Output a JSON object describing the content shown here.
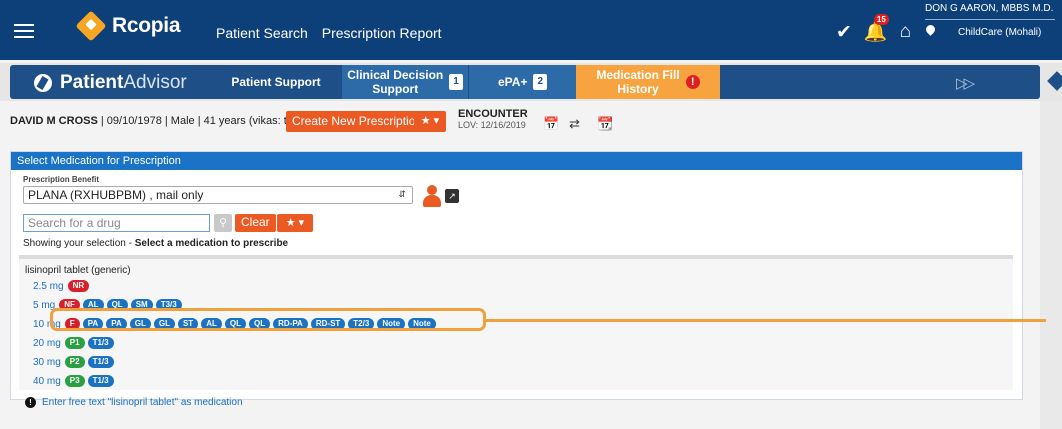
{
  "topbar": {
    "brand": "Rcopia",
    "nav": [
      "Patient Search",
      "Prescription Report"
    ],
    "notification_count": "15",
    "user_name": "DON G AARON, MBBS M.D.",
    "location": "ChildCare (Mohali)"
  },
  "subnav": {
    "logo_bold": "Patient",
    "logo_light": "Advisor",
    "tabs": {
      "patient_support": "Patient Support",
      "cds_line1": "Clinical Decision",
      "cds_line2": "Support",
      "cds_count": "1",
      "epa": "ePA+",
      "epa_count": "2",
      "mfh_line1": "Medication Fill",
      "mfh_line2": "History",
      "mfh_alert": "!"
    }
  },
  "patient": {
    "name": "DAVID M CROSS",
    "details": " | 09/10/1978 | Male | 41 years (vikas: tgy)",
    "create_button": "Create New Prescription",
    "encounter_label": "ENCOUNTER",
    "encounter_lov": "LOV: 12/16/2019"
  },
  "panel": {
    "title": "Select Medication for Prescription",
    "benefit_label": "Prescription Benefit",
    "benefit_value": "PLANA (RXHUBPBM) , mail only",
    "search_placeholder": "Search for a drug",
    "clear_label": "Clear",
    "showing_prefix": "Showing your selection - ",
    "showing_bold": "Select a medication to prescribe",
    "drug_name": "lisinopril tablet (generic)",
    "doses": [
      {
        "label": "2.5 mg",
        "pills": [
          {
            "t": "NR",
            "c": "red"
          }
        ]
      },
      {
        "label": "5 mg",
        "pills": [
          {
            "t": "NF",
            "c": "red"
          },
          {
            "t": "AL",
            "c": "blue"
          },
          {
            "t": "QL",
            "c": "blue"
          },
          {
            "t": "SM",
            "c": "blue"
          },
          {
            "t": "T3/3",
            "c": "blue"
          }
        ]
      },
      {
        "label": "10 mg",
        "pills": [
          {
            "t": "F",
            "c": "red"
          },
          {
            "t": "PA",
            "c": "blue"
          },
          {
            "t": "PA",
            "c": "blue"
          },
          {
            "t": "GL",
            "c": "blue"
          },
          {
            "t": "GL",
            "c": "blue"
          },
          {
            "t": "ST",
            "c": "blue"
          },
          {
            "t": "AL",
            "c": "blue"
          },
          {
            "t": "QL",
            "c": "blue"
          },
          {
            "t": "QL",
            "c": "blue"
          },
          {
            "t": "RD-PA",
            "c": "blue"
          },
          {
            "t": "RD-ST",
            "c": "blue"
          },
          {
            "t": "T2/3",
            "c": "blue"
          },
          {
            "t": "Note",
            "c": "blue"
          },
          {
            "t": "Note",
            "c": "blue"
          }
        ]
      },
      {
        "label": "20 mg",
        "pills": [
          {
            "t": "P1",
            "c": "green"
          },
          {
            "t": "T1/3",
            "c": "blue"
          }
        ]
      },
      {
        "label": "30 mg",
        "pills": [
          {
            "t": "P2",
            "c": "green"
          },
          {
            "t": "T1/3",
            "c": "blue"
          }
        ]
      },
      {
        "label": "40 mg",
        "pills": [
          {
            "t": "P3",
            "c": "green"
          },
          {
            "t": "T1/3",
            "c": "blue"
          }
        ]
      }
    ],
    "freetext": "Enter free text \"lisinopril tablet\" as medication"
  }
}
